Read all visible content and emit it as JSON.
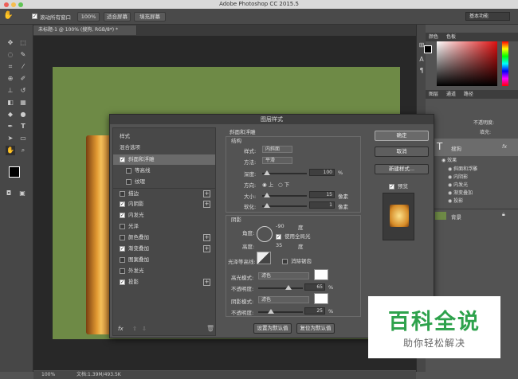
{
  "app": {
    "title": "Adobe Photoshop CC 2015.5"
  },
  "options_bar": {
    "scroll_all_label": "滚动所有窗口",
    "zoom_100": "100%",
    "fit_screen": "适合屏幕",
    "fill_screen": "填充屏幕",
    "workspace": "基本功能"
  },
  "document": {
    "tab_title": "未标题-1 @ 100% (搜狗, RGB/8*) *",
    "status_zoom": "100%",
    "status_doc": "文档:1.39M/493.5K"
  },
  "color_panel": {
    "tabs": [
      "颜色",
      "色板"
    ]
  },
  "layers_panel": {
    "tabs": [
      "图层",
      "通道",
      "路径"
    ],
    "opacity_label": "不透明度:",
    "fill_label": "填充:",
    "layer_name": "搜狗",
    "effects_label": "效果",
    "effects": [
      "斜面和浮雕",
      "内阴影",
      "内发光",
      "渐变叠加",
      "投影"
    ],
    "background": "背景",
    "fx": "fx"
  },
  "dialog": {
    "title": "图层样式",
    "styles_header": "样式",
    "blend_options": "混合选项",
    "items": [
      {
        "label": "斜面和浮雕",
        "checked": true,
        "plus": false
      },
      {
        "label": "等高线",
        "checked": false,
        "plus": false
      },
      {
        "label": "纹理",
        "checked": false,
        "plus": false
      },
      {
        "label": "描边",
        "checked": false,
        "plus": true
      },
      {
        "label": "内阴影",
        "checked": true,
        "plus": true
      },
      {
        "label": "内发光",
        "checked": true,
        "plus": false
      },
      {
        "label": "光泽",
        "checked": false,
        "plus": false
      },
      {
        "label": "颜色叠加",
        "checked": false,
        "plus": true
      },
      {
        "label": "渐变叠加",
        "checked": true,
        "plus": true
      },
      {
        "label": "图案叠加",
        "checked": false,
        "plus": false
      },
      {
        "label": "外发光",
        "checked": false,
        "plus": false
      },
      {
        "label": "投影",
        "checked": true,
        "plus": true
      }
    ],
    "bevel": {
      "title": "斜面和浮雕",
      "structure": "结构",
      "style_label": "样式:",
      "style_value": "内斜面",
      "technique_label": "方法:",
      "technique_value": "平滑",
      "depth_label": "深度:",
      "depth_value": "100",
      "depth_unit": "%",
      "direction_label": "方向:",
      "dir_up": "上",
      "dir_down": "下",
      "size_label": "大小:",
      "size_value": "15",
      "size_unit": "像素",
      "soften_label": "软化:",
      "soften_value": "1",
      "soften_unit": "像素"
    },
    "shading": {
      "title": "阴影",
      "angle_label": "角度:",
      "angle_value": "-90",
      "angle_unit": "度",
      "global_light": "使用全局光",
      "altitude_label": "高度:",
      "altitude_value": "35",
      "altitude_unit": "度",
      "gloss_label": "光泽等高线:",
      "anti_alias": "消除锯齿",
      "highlight_label": "高光模式:",
      "highlight_value": "滤色",
      "hl_opacity_label": "不透明度:",
      "hl_opacity_value": "65",
      "shadow_label": "阴影模式:",
      "shadow_value": "滤色",
      "sh_opacity_label": "不透明度:",
      "sh_opacity_value": "25",
      "pct": "%"
    },
    "set_default": "设置为默认值",
    "reset_default": "复位为默认值",
    "ok": "确定",
    "cancel": "取消",
    "new_style": "新建样式...",
    "preview": "预览",
    "fx": "fx"
  },
  "watermark": {
    "title": "百科全说",
    "subtitle": "助你轻松解决"
  }
}
